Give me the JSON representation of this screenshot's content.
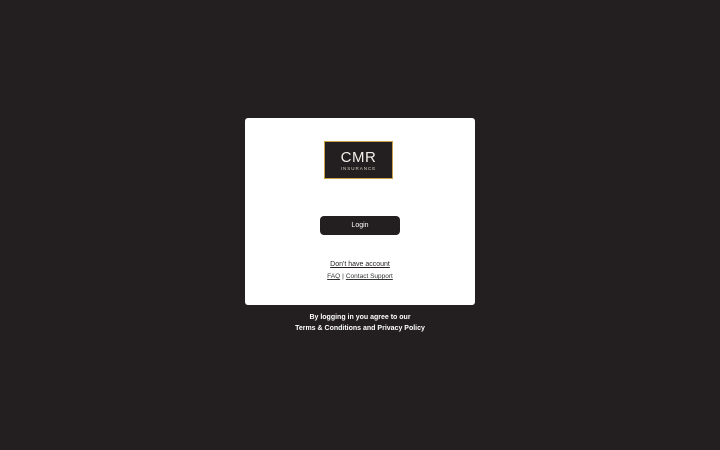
{
  "brand": {
    "name": "CMR",
    "subtitle": "INSURANCE",
    "accent_color": "#c9a14a",
    "dark_color": "#231f20"
  },
  "login": {
    "button_label": "Login"
  },
  "card_links": {
    "no_account": "Don't have account",
    "faq": "FAQ",
    "separator": "|",
    "contact_support": "Contact Support"
  },
  "footer": {
    "line1": "By logging in you agree to our",
    "terms": "Terms & Conditions",
    "and": "and",
    "privacy": "Privacy Policy"
  }
}
